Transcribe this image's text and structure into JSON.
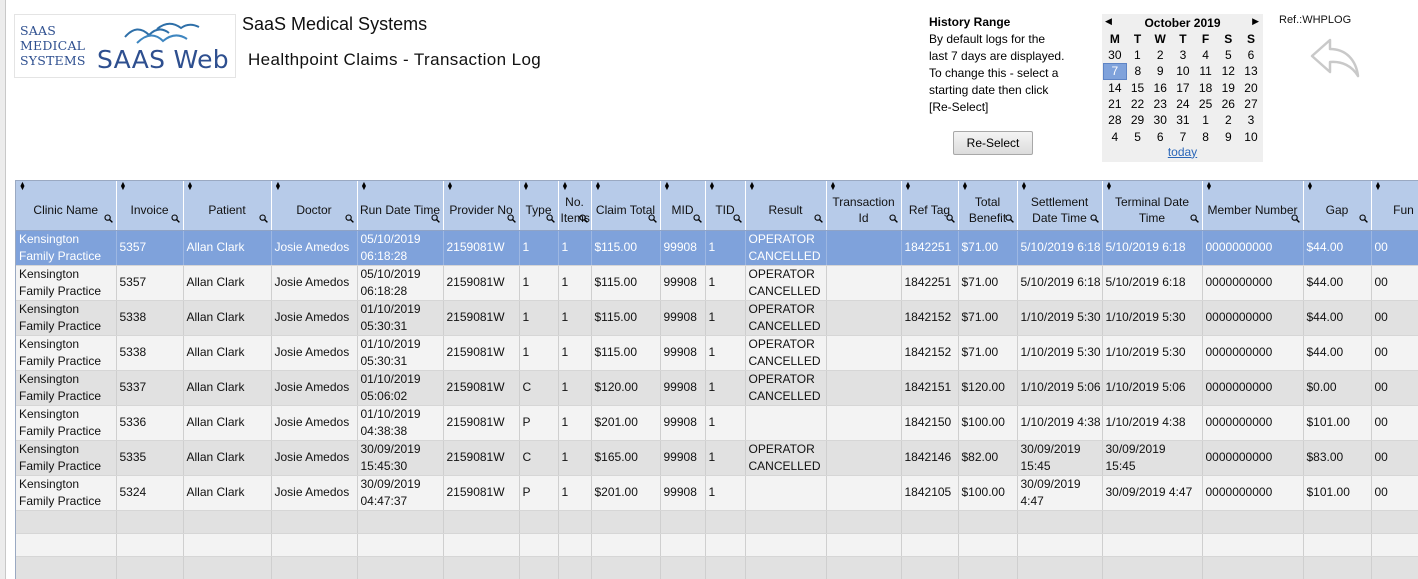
{
  "logo": {
    "line1": "SAAS",
    "line2": "MEDICAL",
    "line3": "SYSTEMS",
    "wordmark": "SAAS Web"
  },
  "header": {
    "company": "SaaS Medical Systems",
    "title": "Healthpoint Claims - Transaction Log",
    "ref": "Ref.:WHPLOG"
  },
  "history": {
    "title": "History Range",
    "line1": "By default logs for the",
    "line2": "last 7 days are displayed.",
    "line3": "To change this - select a",
    "line4": "starting date then click",
    "line5": "[Re-Select]",
    "button": "Re-Select"
  },
  "calendar": {
    "prev": "◀",
    "next": "▶",
    "month": "October 2019",
    "weekdays": [
      "M",
      "T",
      "W",
      "T",
      "F",
      "S",
      "S"
    ],
    "weeks": [
      [
        "30",
        "1",
        "2",
        "3",
        "4",
        "5",
        "6"
      ],
      [
        "7",
        "8",
        "9",
        "10",
        "11",
        "12",
        "13"
      ],
      [
        "14",
        "15",
        "16",
        "17",
        "18",
        "19",
        "20"
      ],
      [
        "21",
        "22",
        "23",
        "24",
        "25",
        "26",
        "27"
      ],
      [
        "28",
        "29",
        "30",
        "31",
        "1",
        "2",
        "3"
      ],
      [
        "4",
        "5",
        "6",
        "7",
        "8",
        "9",
        "10"
      ]
    ],
    "selected": "7",
    "today": "today"
  },
  "grid": {
    "columns": [
      "Clinic Name",
      "Invoice",
      "Patient",
      "Doctor",
      "Run Date Time",
      "Provider No",
      "Type",
      "No. Items",
      "Claim Total",
      "MID",
      "TID",
      "Result",
      "Transaction Id",
      "Ref Tag",
      "Total Benefit",
      "Settlement Date Time",
      "Terminal Date Time",
      "Member Number",
      "Gap",
      "Fun"
    ],
    "rows": [
      [
        "Kensington Family Practice",
        "5357",
        "Allan Clark",
        "Josie Amedos",
        "05/10/2019 06:18:28",
        "2159081W",
        "1",
        "1",
        "$115.00",
        "99908",
        "1",
        "OPERATOR CANCELLED",
        "",
        "1842251",
        "$71.00",
        "5/10/2019 6:18",
        "5/10/2019 6:18",
        "0000000000",
        "$44.00",
        "00"
      ],
      [
        "Kensington Family Practice",
        "5357",
        "Allan Clark",
        "Josie Amedos",
        "05/10/2019 06:18:28",
        "2159081W",
        "1",
        "1",
        "$115.00",
        "99908",
        "1",
        "OPERATOR CANCELLED",
        "",
        "1842251",
        "$71.00",
        "5/10/2019 6:18",
        "5/10/2019 6:18",
        "0000000000",
        "$44.00",
        "00"
      ],
      [
        "Kensington Family Practice",
        "5338",
        "Allan Clark",
        "Josie Amedos",
        "01/10/2019 05:30:31",
        "2159081W",
        "1",
        "1",
        "$115.00",
        "99908",
        "1",
        "OPERATOR CANCELLED",
        "",
        "1842152",
        "$71.00",
        "1/10/2019 5:30",
        "1/10/2019 5:30",
        "0000000000",
        "$44.00",
        "00"
      ],
      [
        "Kensington Family Practice",
        "5338",
        "Allan Clark",
        "Josie Amedos",
        "01/10/2019 05:30:31",
        "2159081W",
        "1",
        "1",
        "$115.00",
        "99908",
        "1",
        "OPERATOR CANCELLED",
        "",
        "1842152",
        "$71.00",
        "1/10/2019 5:30",
        "1/10/2019 5:30",
        "0000000000",
        "$44.00",
        "00"
      ],
      [
        "Kensington Family Practice",
        "5337",
        "Allan Clark",
        "Josie Amedos",
        "01/10/2019 05:06:02",
        "2159081W",
        "C",
        "1",
        "$120.00",
        "99908",
        "1",
        "OPERATOR CANCELLED",
        "",
        "1842151",
        "$120.00",
        "1/10/2019 5:06",
        "1/10/2019 5:06",
        "0000000000",
        "$0.00",
        "00"
      ],
      [
        "Kensington Family Practice",
        "5336",
        "Allan Clark",
        "Josie Amedos",
        "01/10/2019 04:38:38",
        "2159081W",
        "P",
        "1",
        "$201.00",
        "99908",
        "1",
        "",
        "",
        "1842150",
        "$100.00",
        "1/10/2019 4:38",
        "1/10/2019 4:38",
        "0000000000",
        "$101.00",
        "00"
      ],
      [
        "Kensington Family Practice",
        "5335",
        "Allan Clark",
        "Josie Amedos",
        "30/09/2019 15:45:30",
        "2159081W",
        "C",
        "1",
        "$165.00",
        "99908",
        "1",
        "OPERATOR CANCELLED",
        "",
        "1842146",
        "$82.00",
        "30/09/2019 15:45",
        "30/09/2019 15:45",
        "0000000000",
        "$83.00",
        "00"
      ],
      [
        "Kensington Family Practice",
        "5324",
        "Allan Clark",
        "Josie Amedos",
        "30/09/2019 04:47:37",
        "2159081W",
        "P",
        "1",
        "$201.00",
        "99908",
        "1",
        "",
        "",
        "1842105",
        "$100.00",
        "30/09/2019 4:47",
        "30/09/2019 4:47",
        "0000000000",
        "$101.00",
        "00"
      ]
    ],
    "selected_row": 0
  }
}
